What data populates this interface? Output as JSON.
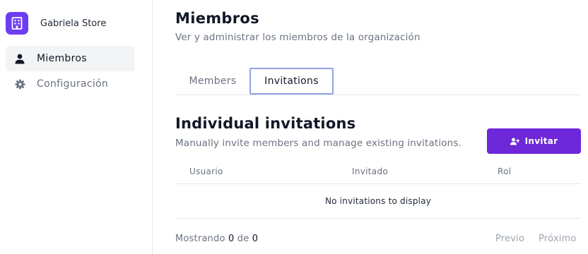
{
  "sidebar": {
    "org_name": "Gabriela Store",
    "org_icon": "building-icon",
    "items": [
      {
        "label": "Miembros",
        "icon": "user-icon",
        "active": true
      },
      {
        "label": "Configuración",
        "icon": "gear-icon",
        "active": false
      }
    ]
  },
  "header": {
    "title": "Miembros",
    "subtitle": "Ver y administrar los miembros de la organización"
  },
  "tabs": [
    {
      "label": "Members",
      "active": false
    },
    {
      "label": "Invitations",
      "active": true
    }
  ],
  "section": {
    "title": "Individual invitations",
    "subtitle": "Manually invite members and manage existing invitations.",
    "invite_button_label": "Invitar",
    "invite_button_icon": "user-plus-icon"
  },
  "table": {
    "columns": [
      "Usuario",
      "Invitado",
      "Rol"
    ],
    "empty_message": "No invitations to display"
  },
  "footer": {
    "showing_prefix": "Mostrando",
    "showing_count": "0",
    "showing_of": "de",
    "showing_total": "0",
    "prev_label": "Previo",
    "next_label": "Próximo"
  },
  "colors": {
    "brand": "#6d28d9",
    "org_logo": "#6d3df2",
    "active_tab_outline": "#8fa2e3"
  }
}
